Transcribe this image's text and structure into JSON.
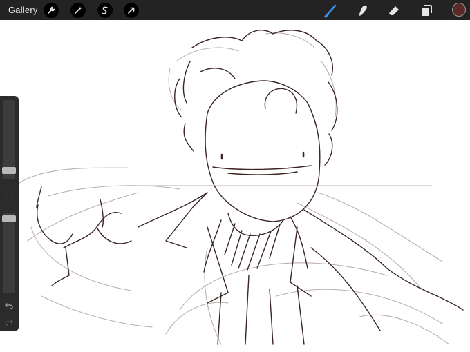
{
  "toolbar": {
    "gallery_label": "Gallery",
    "actions_icon": "wrench-icon",
    "adjustments_icon": "magic-wand-icon",
    "selection_icon": "selection-s-icon",
    "transform_icon": "arrow-cursor-icon",
    "brush_icon": "brush-icon",
    "smudge_icon": "smudge-finger-icon",
    "eraser_icon": "eraser-icon",
    "layers_icon": "layers-icon",
    "active_color": "#5a2a28",
    "brush_active_color": "#3b8cf0"
  },
  "sidebar": {
    "brush_size_level": 0.38,
    "opacity_level": 0.07,
    "undo_icon": "undo-icon",
    "redo_icon": "redo-icon"
  },
  "canvas": {
    "background": "#ffffff",
    "ink_color": "#3a2424",
    "sketch_color": "#b8b0b0"
  }
}
